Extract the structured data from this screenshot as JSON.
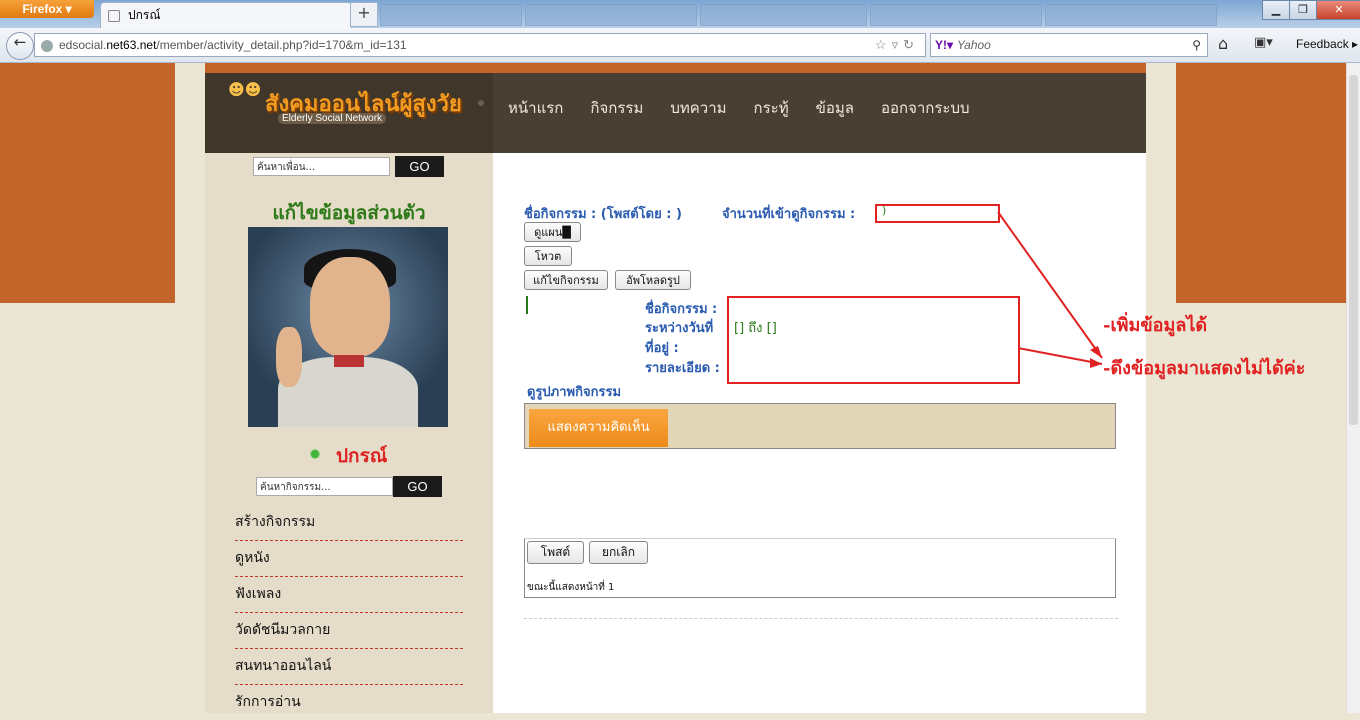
{
  "browser": {
    "app_button": "Firefox",
    "tab_title": "ปกรณ์",
    "new_tab": "+",
    "url_host_prefix": "edsocial.",
    "url_host_domain": "net63.net",
    "url_path": "/member/activity_detail.php?id=170&m_id=131",
    "search_placeholder": "Yahoo",
    "feedback_label": "Feedback"
  },
  "site": {
    "logo_title": "สังคมออนไลน์ผู้สูงวัย",
    "logo_subtitle": "Elderly Social Network",
    "menu": [
      "หน้าแรก",
      "กิจกรรม",
      "บทความ",
      "กระทู้",
      "ข้อมูล",
      "ออกจากระบบ"
    ]
  },
  "sidebar": {
    "friend_search_placeholder": "ค้นหาเพื่อน...",
    "go_label": "GO",
    "edit_profile_title": "แก้ไขข้อมูลส่วนตัว",
    "username": "ปกรณ์",
    "activity_search_placeholder": "ค้นหากิจกรรม...",
    "links": [
      "สร้างกิจกรรม",
      "ดูหนัง",
      "ฟังเพลง",
      "วัดดัชนีมวลกาย",
      "สนทนาออนไลน์",
      "รักการอ่าน"
    ]
  },
  "activity": {
    "header_label": "ชื่อกิจกรรม : (โพสต์โดย : )",
    "views_label": "จำนวนที่เข้าดูกิจกรรม :",
    "views_value": ")",
    "btn_map": "ดูแผน",
    "btn_vote": "โหวต",
    "btn_edit": "แก้ไขกิจกรรม",
    "btn_upload": "อัพโหลดรูป",
    "field_name": "ชื่อกิจกรรม :",
    "field_dates": "ระหว่างวันที่",
    "field_dates_value": "[] ถึง []",
    "field_location": "ที่อยู่ :",
    "field_details": "รายละเอียด :",
    "view_photos": "ดูรูปภาพกิจกรรม"
  },
  "annotations": {
    "note_1": "-เพิ่มข้อมูลได้",
    "note_2": "-ดึงข้อมูลมาแสดงไม่ได้ค่ะ"
  },
  "comments": {
    "tab_label": "แสดงความคิดเห็น",
    "post_button": "โพสต์",
    "cancel_button": "ยกเลิก",
    "page_status": "ขณะนี้แสดงหน้าที่ 1"
  },
  "colors": {
    "accent_orange": "#c3652b",
    "header_dark": "#4a3f34",
    "link_blue": "#2a5bb0",
    "annotation_red": "#e02222"
  }
}
